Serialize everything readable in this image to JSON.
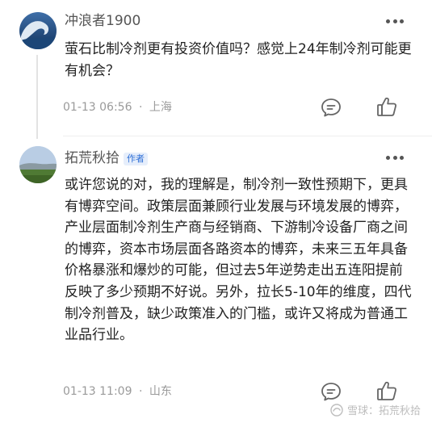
{
  "comments": [
    {
      "username": "冲浪者1900",
      "avatar": "wave-avatar",
      "text": "萤石比制冷剂更有投资价值吗？感觉上24年制冷剂可能更有机会？",
      "time": "01-13 06:56",
      "separator": "·",
      "location": "上海"
    },
    {
      "username": "拓荒秋拾",
      "badge": "作者",
      "avatar": "landscape-avatar",
      "text": "或许您说的对，我的理解是，制冷剂一致性预期下，更具有博弈空间。政策层面兼顾行业发展与环境发展的博弈，产业层面制冷剂生产商与经销商、下游制冷设备厂商之间的博弈，资本市场层面各路资本的博弈，未来三五年具备价格暴涨和爆炒的可能，但过去5年逆势走出五连阳提前反映了多少预期不好说。另外，拉长5-10年的维度，四代制冷剂普及，缺少政策准入的门槛，或许又将成为普通工业品行业。",
      "time": "01-13 11:09",
      "separator": "·",
      "location": "山东"
    }
  ],
  "watermark": "雪球：拓荒秋拾",
  "icons": [
    "more-icon",
    "reply-icon",
    "like-icon",
    "snowball-logo-icon"
  ],
  "colors": {
    "badge": "#2d6fd6",
    "meta": "#9a9a9a",
    "icon": "#666666"
  }
}
